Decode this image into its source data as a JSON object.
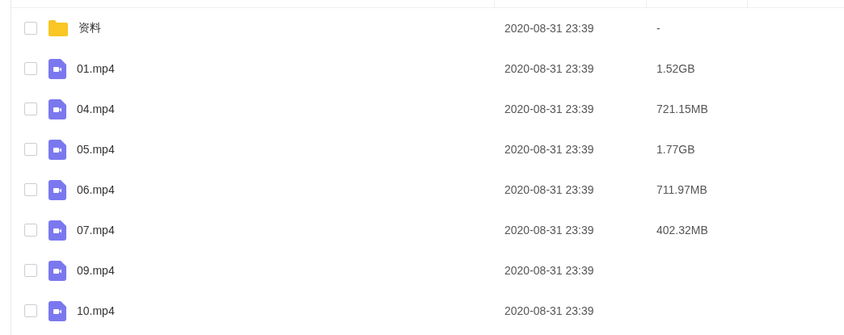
{
  "files": [
    {
      "kind": "folder",
      "name": "资料",
      "checked": false,
      "date": "2020-08-31 23:39",
      "size": "-"
    },
    {
      "kind": "video",
      "name": "01.mp4",
      "checked": false,
      "date": "2020-08-31 23:39",
      "size": "1.52GB"
    },
    {
      "kind": "video",
      "name": "04.mp4",
      "checked": false,
      "date": "2020-08-31 23:39",
      "size": "721.15MB"
    },
    {
      "kind": "video",
      "name": "05.mp4",
      "checked": false,
      "date": "2020-08-31 23:39",
      "size": "1.77GB"
    },
    {
      "kind": "video",
      "name": "06.mp4",
      "checked": false,
      "date": "2020-08-31 23:39",
      "size": "711.97MB"
    },
    {
      "kind": "video",
      "name": "07.mp4",
      "checked": false,
      "date": "2020-08-31 23:39",
      "size": "402.32MB"
    },
    {
      "kind": "video",
      "name": "09.mp4",
      "checked": false,
      "date": "2020-08-31 23:39"
    },
    {
      "kind": "video",
      "name": "10.mp4",
      "checked": false,
      "date": "2020-08-31 23:39"
    }
  ]
}
